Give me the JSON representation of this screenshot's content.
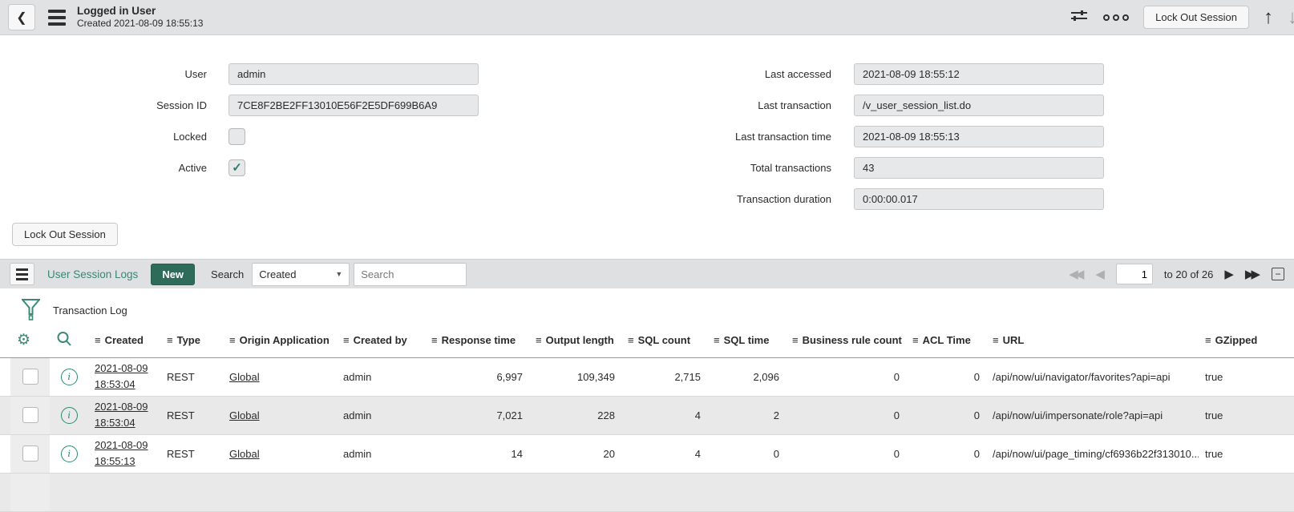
{
  "header": {
    "title": "Logged in User",
    "subtitle": "Created 2021-08-09 18:55:13"
  },
  "actions": {
    "lock_out_session": "Lock Out Session"
  },
  "form": {
    "left": [
      {
        "label": "User",
        "value": "admin",
        "type": "text"
      },
      {
        "label": "Session ID",
        "value": "7CE8F2BE2FF13010E56F2E5DF699B6A9",
        "type": "text"
      },
      {
        "label": "Locked",
        "checked": false,
        "type": "checkbox"
      },
      {
        "label": "Active",
        "checked": true,
        "type": "checkbox"
      }
    ],
    "right": [
      {
        "label": "Last accessed",
        "value": "2021-08-09 18:55:12"
      },
      {
        "label": "Last transaction",
        "value": "/v_user_session_list.do"
      },
      {
        "label": "Last transaction time",
        "value": "2021-08-09 18:55:13"
      },
      {
        "label": "Total transactions",
        "value": "43"
      },
      {
        "label": "Transaction duration",
        "value": "0:00:00.017"
      }
    ]
  },
  "list": {
    "title": "User Session Logs",
    "new_button": "New",
    "search_label": "Search",
    "search_field_selected": "Created",
    "search_placeholder": "Search",
    "pagination": {
      "page": "1",
      "range_text": "to 20 of 26"
    },
    "filter_breadcrumb": "Transaction Log",
    "columns": [
      "Created",
      "Type",
      "Origin Application",
      "Created by",
      "Response time",
      "Output length",
      "SQL count",
      "SQL time",
      "Business rule count",
      "ACL Time",
      "URL",
      "GZipped"
    ],
    "rows": [
      {
        "created": "2021-08-09 18:53:04",
        "type": "REST",
        "origin": "Global",
        "created_by": "admin",
        "response_time": "6,997",
        "output_length": "109,349",
        "sql_count": "2,715",
        "sql_time": "2,096",
        "br_count": "0",
        "acl_time": "0",
        "url": "/api/now/ui/navigator/favorites?api=api",
        "gzipped": "true"
      },
      {
        "created": "2021-08-09 18:53:04",
        "type": "REST",
        "origin": "Global",
        "created_by": "admin",
        "response_time": "7,021",
        "output_length": "228",
        "sql_count": "4",
        "sql_time": "2",
        "br_count": "0",
        "acl_time": "0",
        "url": "/api/now/ui/impersonate/role?api=api",
        "gzipped": "true"
      },
      {
        "created": "2021-08-09 18:55:13",
        "type": "REST",
        "origin": "Global",
        "created_by": "admin",
        "response_time": "14",
        "output_length": "20",
        "sql_count": "4",
        "sql_time": "0",
        "br_count": "0",
        "acl_time": "0",
        "url": "/api/now/ui/page_timing/cf6936b22f313010...",
        "gzipped": "true"
      }
    ]
  },
  "icons": {
    "back": "❮",
    "sort": "≡",
    "caret_down": "▼",
    "check": "✓",
    "first_page": "◀◀",
    "prev_page": "◀",
    "next_page": "▶",
    "last_page": "▶▶",
    "collapse": "−",
    "up_arrow": "↑",
    "down_arrow": "↓",
    "gear": "⚙"
  },
  "colors": {
    "accent_teal": "#3a8772",
    "new_button_green": "#2e6c59",
    "bar_gray": "#e1e2e4",
    "field_gray": "#e7e8ea",
    "row_alt_gray": "#e9e9ea"
  }
}
